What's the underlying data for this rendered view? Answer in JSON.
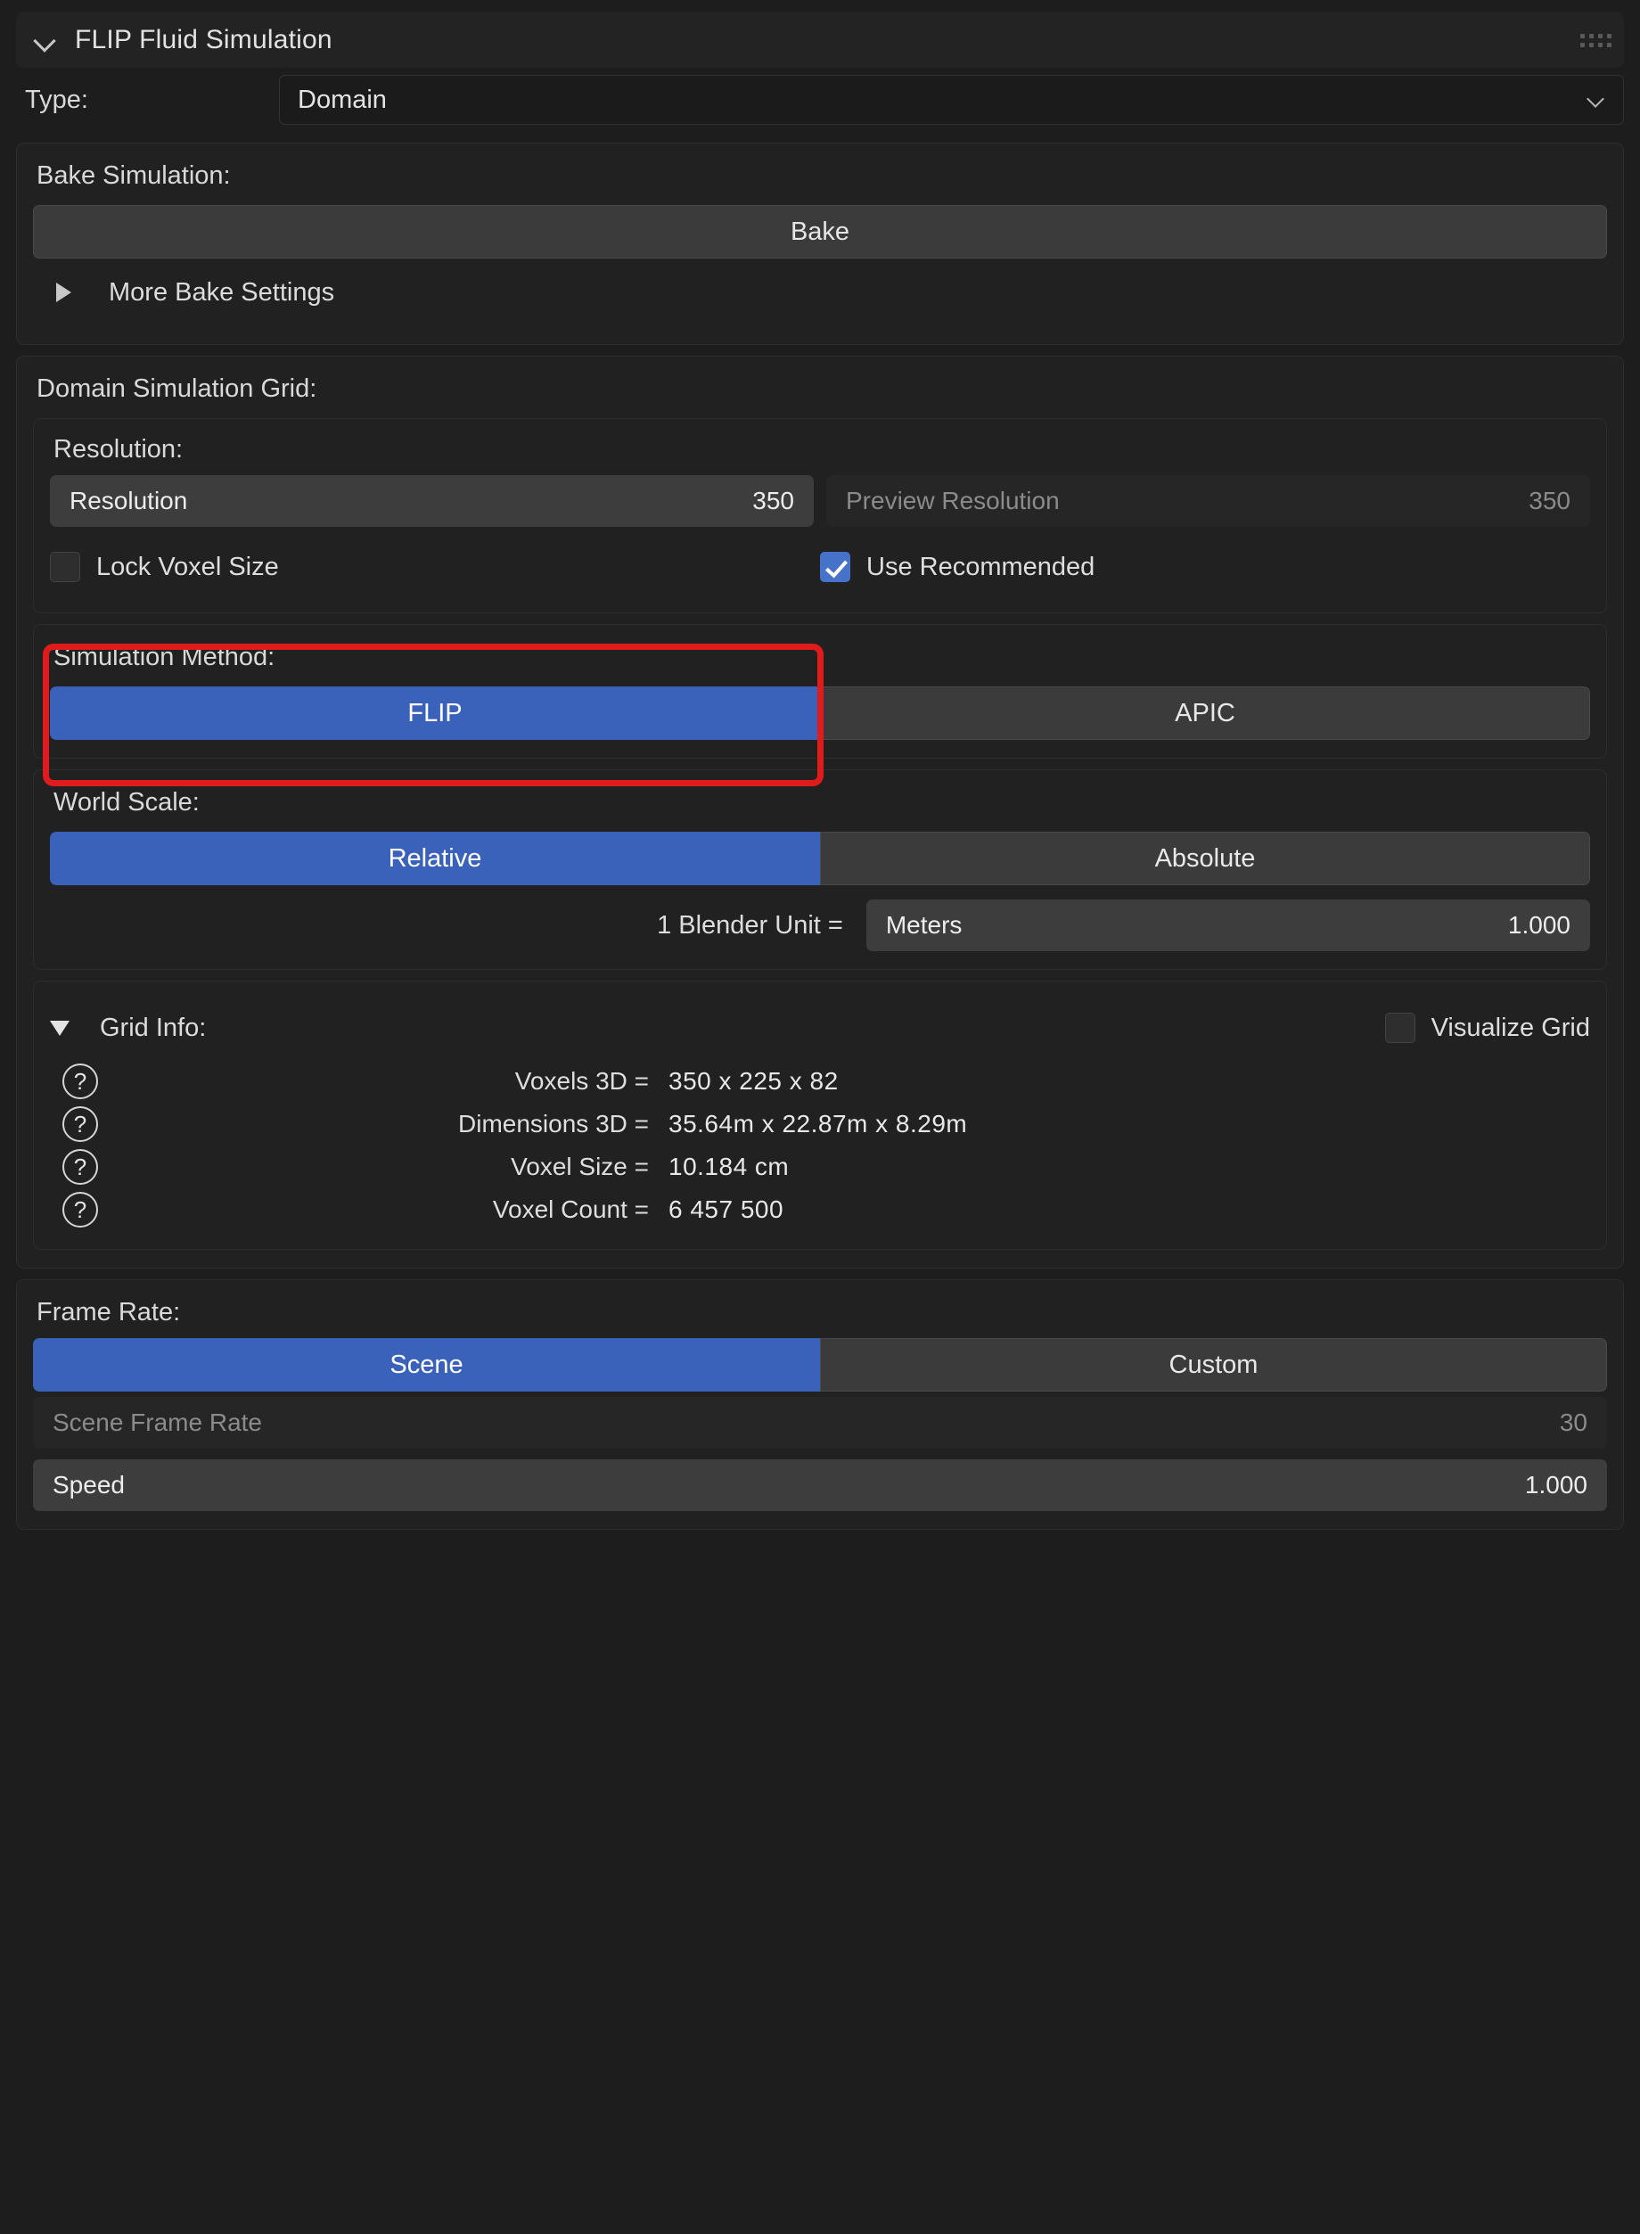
{
  "panel": {
    "title": "FLIP Fluid Simulation",
    "collapse_icon": "chevron-down-icon",
    "grip_icon": "drag-grip-icon"
  },
  "type_row": {
    "label": "Type:",
    "value": "Domain",
    "chevron_icon": "chevron-down-icon"
  },
  "bake": {
    "section_label": "Bake Simulation:",
    "bake_button": "Bake",
    "more_settings": "More Bake Settings",
    "more_settings_icon": "triangle-right-icon"
  },
  "grid": {
    "section_label": "Domain Simulation Grid:",
    "resolution_label": "Resolution:",
    "resolution": {
      "name": "Resolution",
      "value": "350"
    },
    "preview_resolution": {
      "name": "Preview Resolution",
      "value": "350"
    },
    "lock_voxel_size": {
      "label": "Lock Voxel Size",
      "checked": false
    },
    "use_recommended": {
      "label": "Use Recommended",
      "checked": true
    }
  },
  "sim_method": {
    "section_label": "Simulation Method:",
    "options": [
      "FLIP",
      "APIC"
    ],
    "selected": "FLIP"
  },
  "world_scale": {
    "section_label": "World Scale:",
    "options": [
      "Relative",
      "Absolute"
    ],
    "selected": "Relative",
    "unit_label": "1 Blender Unit =",
    "unit_name": "Meters",
    "unit_value": "1.000"
  },
  "grid_info": {
    "section_label": "Grid Info:",
    "disclosure_icon": "triangle-down-icon",
    "visualize_grid": {
      "label": "Visualize Grid",
      "checked": false
    },
    "rows": [
      {
        "icon": "question-mark-icon",
        "key": "Voxels 3D =",
        "value": "350  x  225  x  82"
      },
      {
        "icon": "question-mark-icon",
        "key": "Dimensions 3D =",
        "value": "35.64m  x  22.87m  x  8.29m"
      },
      {
        "icon": "question-mark-icon",
        "key": "Voxel Size =",
        "value": "10.184 cm"
      },
      {
        "icon": "question-mark-icon",
        "key": "Voxel Count =",
        "value": "6 457 500"
      }
    ]
  },
  "frame_rate": {
    "section_label": "Frame Rate:",
    "options": [
      "Scene",
      "Custom"
    ],
    "selected": "Scene",
    "scene_frame_rate": {
      "name": "Scene Frame Rate",
      "value": "30"
    },
    "speed": {
      "name": "Speed",
      "value": "1.000"
    }
  },
  "annotation": {
    "highlight_color": "#e01b1b",
    "target": "resolution-field-group"
  },
  "colors": {
    "accent_blue": "#3a62ba",
    "checkbox_blue": "#4772c9",
    "panel_bg": "#1d1d1d",
    "card_bg": "#212121",
    "field_active": "#3d3d3d",
    "field_muted": "#262626"
  }
}
